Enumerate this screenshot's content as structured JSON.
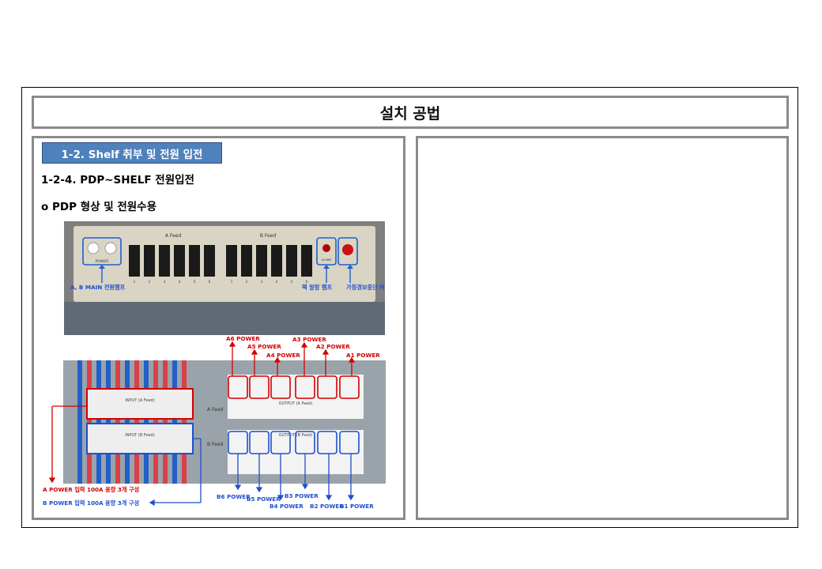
{
  "slide_title": "설치 공법",
  "section_badge": "1-2. Shelf 취부 및 전원 입전",
  "subheading": "1-2-4. PDP~SHELF 전원입전",
  "bullet": "o   PDP 형상 및 전원수용",
  "photo_top": {
    "a_feed": "A Feed",
    "b_feed": "B Feed",
    "main_lamp": "A, B MAIN 전원램프",
    "alarm_lamp": "랙 알람 램프",
    "alarm_button": "가청경보중단 버튼",
    "power_text": "POWER",
    "alarm_text": "ALARM",
    "breaker_numbers": [
      "1",
      "2",
      "3",
      "4",
      "5",
      "6"
    ]
  },
  "photo_bottom": {
    "top_labels": [
      "A6 POWER",
      "A5 POWER",
      "A4 POWER",
      "A3 POWER",
      "A2 POWER",
      "A1 POWER"
    ],
    "bottom_labels": [
      "B6 POWER",
      "B5 POWER",
      "B4 POWER",
      "B3 POWER",
      "B2 POWER",
      "B1 POWER"
    ],
    "input_a": "INPUT (A Feed)",
    "input_b": "INPUT (B Feed)",
    "output_a": "OUTPUT (A Feed)",
    "output_b": "OUTPUT (B Feed)",
    "a_feed_side": "A Feed",
    "b_feed_side": "B Feed",
    "a_power_input": "A POWER 입력  100A 용량 3개 구성",
    "b_power_input": "B POWER 입력  100A 용량 3개 구성"
  },
  "colors": {
    "accent_blue": "#4f81bd",
    "red": "#d40000",
    "blue": "#1f4fd0",
    "border_gray": "#8a8a8a"
  }
}
